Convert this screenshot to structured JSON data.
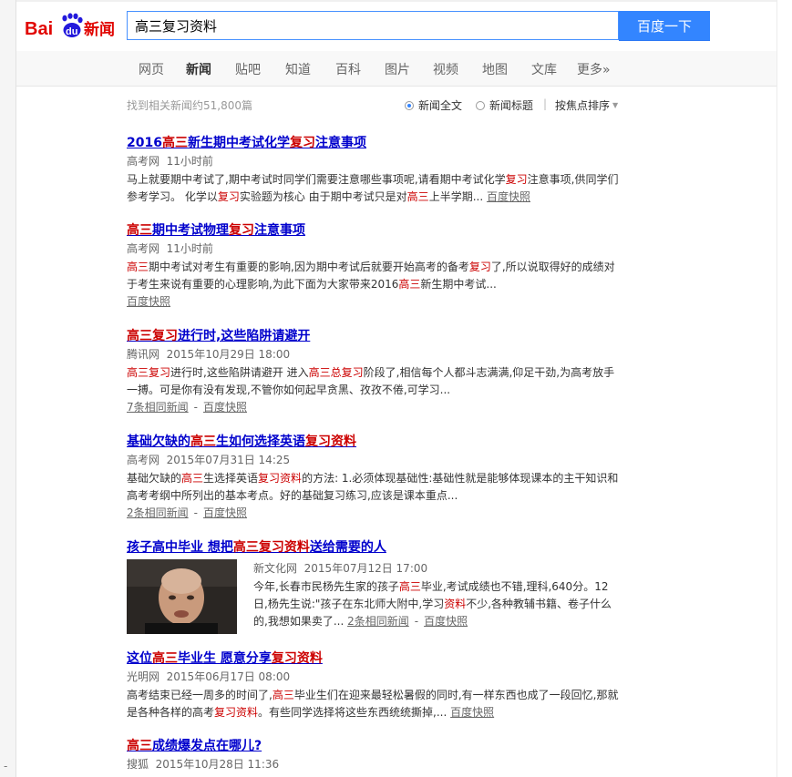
{
  "search": {
    "query": "高三复习资料",
    "button": "百度一下"
  },
  "logo": {
    "text_bai": "Bai",
    "text_du": "du",
    "text_news": "新闻"
  },
  "nav": {
    "items": [
      {
        "label": "网页"
      },
      {
        "label": "新闻"
      },
      {
        "label": "贴吧"
      },
      {
        "label": "知道"
      },
      {
        "label": "百科"
      },
      {
        "label": "图片"
      },
      {
        "label": "视频"
      },
      {
        "label": "地图"
      },
      {
        "label": "文库"
      },
      {
        "label": "更多»"
      }
    ],
    "active": "新闻"
  },
  "toolbar": {
    "count": "找到相关新闻约51,800篇",
    "full_text": "新闻全文",
    "title_only": "新闻标题",
    "separator": "|",
    "sort": "按焦点排序"
  },
  "results": [
    {
      "title": [
        "2016",
        "高三",
        "新生期中考试化学",
        "复习",
        "注意事项"
      ],
      "source": "高考网",
      "time": "11小时前",
      "abstract": [
        "马上就要期中考试了,期中考试时同学们需要注意哪些事项呢,请看期中考试化学",
        "复习",
        "注意事项,供同学们参考学习。 化学以",
        "复习",
        "实验题为核心 由于期中考试只是对",
        "高三",
        "上半学期..."
      ],
      "cache": "百度快照"
    },
    {
      "title": [
        "高三",
        "期中考试物理",
        "复习",
        "注意事项"
      ],
      "source": "高考网",
      "time": "11小时前",
      "abstract": [
        "高三",
        "期中考试对考生有重要的影响,因为期中考试后就要开始高考的备考",
        "复习",
        "了,所以说取得好的成绩对于考生来说有重要的心理影响,为此下面为大家带来2016",
        "高三",
        "新生期中考试..."
      ],
      "cache": "百度快照"
    },
    {
      "title": [
        "高三复习",
        "进行时,这些陷阱请避开"
      ],
      "source": "腾讯网",
      "time": "2015年10月29日 18:00",
      "abstract": [
        "高三复习",
        "进行时,这些陷阱请避开 进入",
        "高三总复习",
        "阶段了,相信每个人都斗志满满,仰足干劲,为高考放手一搏。可是你有没有发现,不管你如何起早贪黑、孜孜不倦,可学习..."
      ],
      "related": "7条相同新闻",
      "cache": "百度快照"
    },
    {
      "title": [
        "基础欠缺的",
        "高三",
        "生如何选择英语",
        "复习资料"
      ],
      "source": "高考网",
      "time": "2015年07月31日 14:25",
      "abstract": [
        "基础欠缺的",
        "高三",
        "生选择英语",
        "复习资料",
        "的方法: 1.必须体现基础性:基础性就是能够体现课本的主干知识和高考考纲中所列出的基本考点。好的基础复习练习,应该是课本重点..."
      ],
      "related": "2条相同新闻",
      "cache": "百度快照"
    },
    {
      "title": [
        "孩子高中毕业 想把",
        "高三复习资料",
        "送给需要的人"
      ],
      "source": "新文化网",
      "time": "2015年07月12日 17:00",
      "abstract": [
        "今年,长春市民杨先生家的孩子",
        "高三",
        "毕业,考试成绩也不错,理科,640分。12日,杨先生说:\"孩子在东北师大附中,学习",
        "资料",
        "不少,各种教辅书籍、卷子什么的,我想如果卖了..."
      ],
      "related": "2条相同新闻",
      "cache": "百度快照"
    },
    {
      "title": [
        "这位",
        "高三",
        "毕业生 愿意分享",
        "复习资料"
      ],
      "source": "光明网",
      "time": "2015年06月17日 08:00",
      "abstract": [
        "高考结束已经一周多的时间了,",
        "高三",
        "毕业生们在迎来最轻松暑假的同时,有一样东西也成了一段回忆,那就是各种各样的高考",
        "复习资料",
        "。有些同学选择将这些东西统统撕掉,..."
      ],
      "cache": "百度快照"
    },
    {
      "title": [
        "高三",
        "成绩爆发点在哪儿?"
      ],
      "source": "搜狐",
      "time": "2015年10月28日 11:36"
    }
  ],
  "gutter": {
    "mark": "-"
  },
  "colors": {
    "link": "#0000cc",
    "highlight": "#cc0000",
    "accent": "#3385ff",
    "logo_red": "#e10602",
    "logo_blue": "#2319dc"
  }
}
